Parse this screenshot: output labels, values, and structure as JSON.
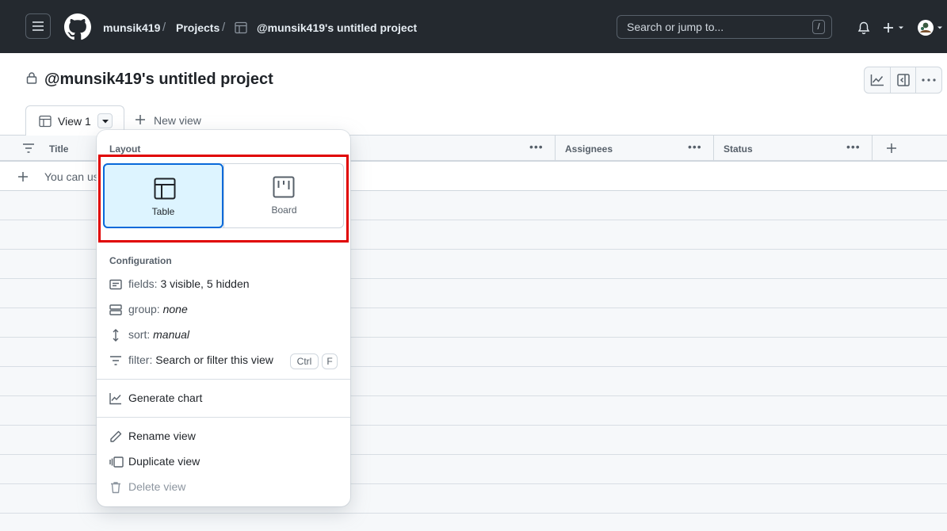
{
  "header": {
    "user": "munsik419",
    "projects_link": "Projects",
    "project_crumb": "@munsik419's untitled project",
    "search_placeholder": "Search or jump to...",
    "search_shortcut": "/"
  },
  "project": {
    "title": "@munsik419's untitled project"
  },
  "tabs": {
    "active": "View 1",
    "new_view": "New view"
  },
  "table": {
    "columns": [
      "Title",
      "Assignees",
      "Status"
    ],
    "add_row_text": "You can us"
  },
  "view_menu": {
    "layout_heading": "Layout",
    "layout_options": [
      "Table",
      "Board"
    ],
    "selected_layout": "Table",
    "configuration_heading": "Configuration",
    "fields_label": "fields:",
    "fields_value": "3 visible, 5 hidden",
    "group_label": "group:",
    "group_value": "none",
    "sort_label": "sort:",
    "sort_value": "manual",
    "filter_label": "filter:",
    "filter_value": "Search or filter this view",
    "filter_keys": [
      "Ctrl",
      "F"
    ],
    "generate_chart": "Generate chart",
    "rename_view": "Rename view",
    "duplicate_view": "Duplicate view",
    "delete_view": "Delete view"
  },
  "colors": {
    "header_bg": "#24292f",
    "accent": "#0969da",
    "selected_bg": "#ddf4ff",
    "highlight_box": "#e00000"
  }
}
